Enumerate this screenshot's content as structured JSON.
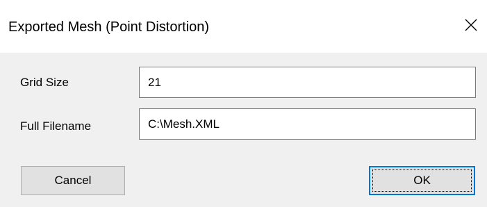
{
  "window": {
    "title": "Exported Mesh (Point Distortion)",
    "close_icon": "close-icon"
  },
  "form": {
    "grid_size": {
      "label": "Grid Size",
      "value": "21"
    },
    "full_filename": {
      "label": "Full Filename",
      "value": "C:\\Mesh.XML"
    }
  },
  "buttons": {
    "cancel_label": "Cancel",
    "ok_label": "OK"
  },
  "colors": {
    "titlebar_bg": "#ffffff",
    "dialog_bg": "#f0f0f0",
    "field_border": "#7a7a7a",
    "button_bg": "#e1e1e1",
    "default_button_border": "#0078d7"
  }
}
